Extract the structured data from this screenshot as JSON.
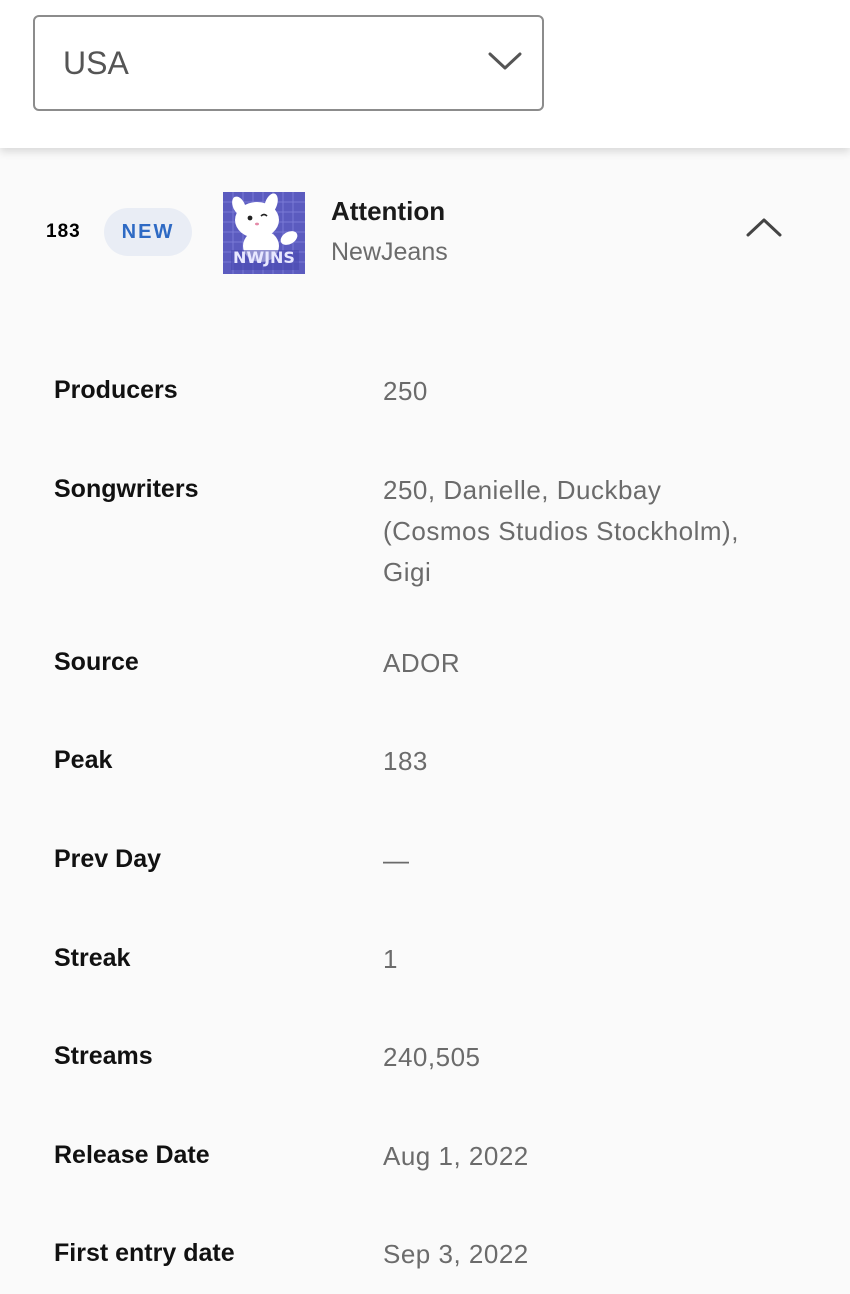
{
  "country_select": {
    "value": "USA",
    "icon": "chevron-down-icon"
  },
  "track": {
    "rank": "183",
    "badge": "NEW",
    "title": "Attention",
    "artist": "NewJeans",
    "cover_text": "NWJNS",
    "collapse_icon": "chevron-up-icon"
  },
  "details": [
    {
      "label": "Producers",
      "value": "250"
    },
    {
      "label": "Songwriters",
      "value": "250, Danielle, Duckbay (Cosmos Studios Stockholm), Gigi"
    },
    {
      "label": "Source",
      "value": "ADOR"
    },
    {
      "label": "Peak",
      "value": "183"
    },
    {
      "label": "Prev Day",
      "value": "—"
    },
    {
      "label": "Streak",
      "value": "1"
    },
    {
      "label": "Streams",
      "value": "240,505"
    },
    {
      "label": "Release Date",
      "value": "Aug 1, 2022"
    },
    {
      "label": "First entry date",
      "value": "Sep 3, 2022"
    }
  ],
  "colors": {
    "badge_bg": "#e9edf5",
    "badge_text": "#2e6ac4",
    "value_text": "#6b6b6b",
    "cover_bg": "#5454b8"
  }
}
